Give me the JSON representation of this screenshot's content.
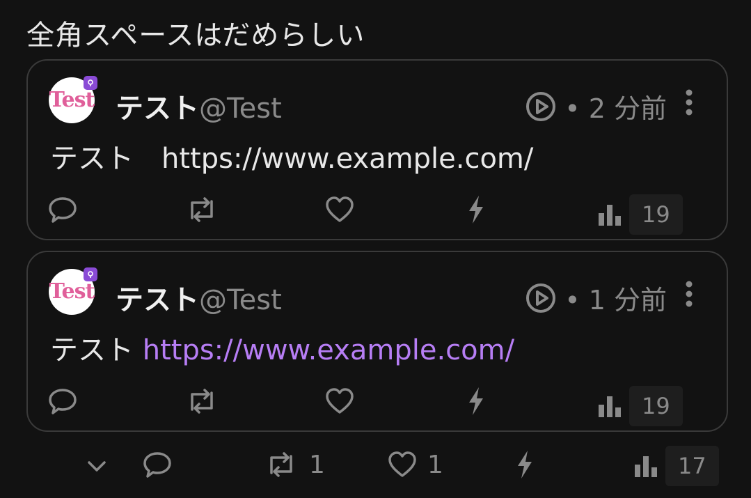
{
  "top_text": "全角スペースはだめらしい",
  "posts": [
    {
      "avatar_text": "Test",
      "name": "テスト",
      "handle": "@Test",
      "time": "• 2 分前",
      "text": "テスト　",
      "link": "https://www.example.com/",
      "views": "19"
    },
    {
      "avatar_text": "Test",
      "name": "テスト",
      "handle": "@Test",
      "time": "• 1 分前",
      "text": "テスト ",
      "link": "https://www.example.com/",
      "views": "19"
    }
  ],
  "footer": {
    "repost_count": "1",
    "like_count": "1",
    "views": "17"
  },
  "colors": {
    "background": "#121212",
    "link": "#b77ef5",
    "badge": "#8a4bd6",
    "avatar_text": "#e05f9a"
  }
}
